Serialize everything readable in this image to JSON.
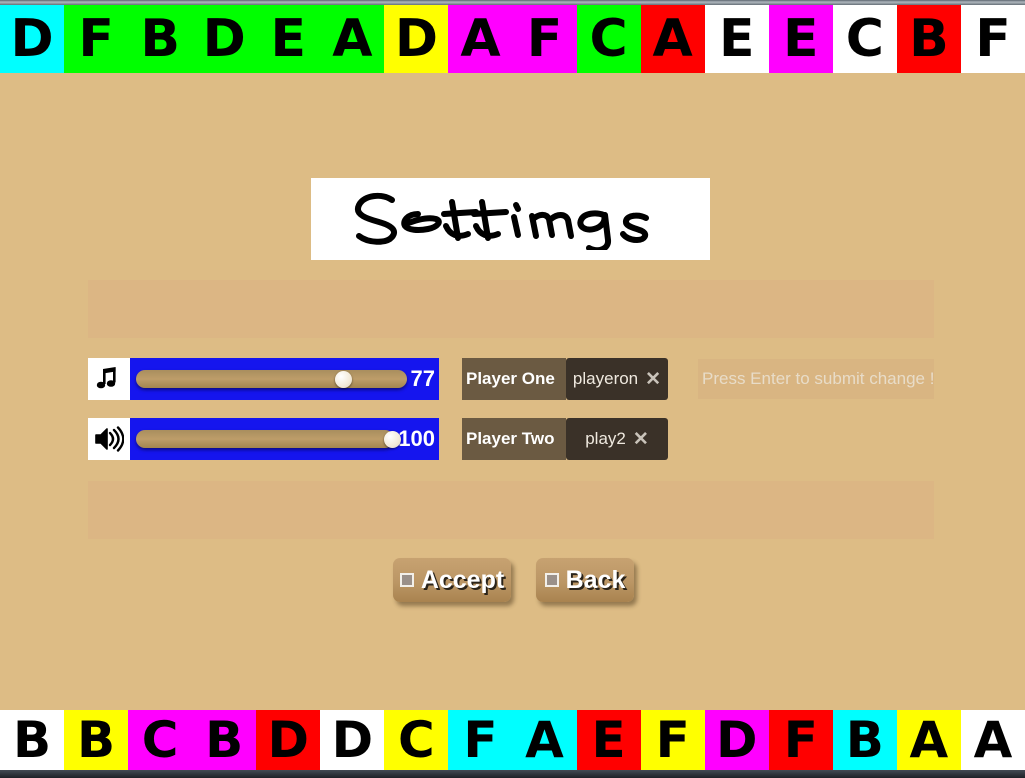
{
  "window": {
    "title": "Settings"
  },
  "top_strip": {
    "name": "top-letter-strip",
    "tiles": [
      {
        "letter": "D",
        "bg": "#00ffff"
      },
      {
        "letter": "F",
        "bg": "#00ff00"
      },
      {
        "letter": "B",
        "bg": "#00ff00"
      },
      {
        "letter": "D",
        "bg": "#00ff00"
      },
      {
        "letter": "E",
        "bg": "#00ff00"
      },
      {
        "letter": "A",
        "bg": "#00ff00"
      },
      {
        "letter": "D",
        "bg": "#ffff00"
      },
      {
        "letter": "A",
        "bg": "#ff00ff"
      },
      {
        "letter": "F",
        "bg": "#ff00ff"
      },
      {
        "letter": "C",
        "bg": "#00ff00"
      },
      {
        "letter": "A",
        "bg": "#ff0000"
      },
      {
        "letter": "E",
        "bg": "#ffffff"
      },
      {
        "letter": "E",
        "bg": "#ff00ff"
      },
      {
        "letter": "C",
        "bg": "#ffffff"
      },
      {
        "letter": "B",
        "bg": "#ff0000"
      },
      {
        "letter": "F",
        "bg": "#ffffff"
      }
    ]
  },
  "bottom_strip": {
    "name": "bottom-letter-strip",
    "tiles": [
      {
        "letter": "B",
        "bg": "#ffffff"
      },
      {
        "letter": "B",
        "bg": "#ffff00"
      },
      {
        "letter": "C",
        "bg": "#ff00ff"
      },
      {
        "letter": "B",
        "bg": "#ff00ff"
      },
      {
        "letter": "D",
        "bg": "#ff0000"
      },
      {
        "letter": "D",
        "bg": "#ffffff"
      },
      {
        "letter": "C",
        "bg": "#ffff00"
      },
      {
        "letter": "F",
        "bg": "#00ffff"
      },
      {
        "letter": "A",
        "bg": "#00ffff"
      },
      {
        "letter": "E",
        "bg": "#ff0000"
      },
      {
        "letter": "F",
        "bg": "#ffff00"
      },
      {
        "letter": "D",
        "bg": "#ff00ff"
      },
      {
        "letter": "F",
        "bg": "#ff0000"
      },
      {
        "letter": "B",
        "bg": "#00ffff"
      },
      {
        "letter": "A",
        "bg": "#ffff00"
      },
      {
        "letter": "A",
        "bg": "#ffffff"
      }
    ]
  },
  "title": {
    "text": "Settings",
    "style": "handwritten",
    "banner_bg": "#ffffff",
    "ink": "#000000"
  },
  "sliders": [
    {
      "id": "music-volume",
      "icon": "music-note-icon",
      "value": 77,
      "min": 0,
      "max": 100,
      "value_label": "77",
      "track_bg": "#b1九",
      "panel_bg": "#1515ee"
    },
    {
      "id": "sound-volume",
      "icon": "speaker-volume-icon",
      "value": 100,
      "min": 0,
      "max": 100,
      "value_label": "100",
      "panel_bg": "#1515ee"
    }
  ],
  "players": [
    {
      "id": "player-one",
      "label": "Player One",
      "value": "playeron",
      "clear_glyph": "✕"
    },
    {
      "id": "player-two",
      "label": "Player Two",
      "value": "play2",
      "clear_glyph": "✕"
    }
  ],
  "hint": {
    "text": "Press Enter to submit change !"
  },
  "buttons": [
    {
      "id": "accept-button",
      "label": "Accept"
    },
    {
      "id": "back-button",
      "label": "Back"
    }
  ],
  "colors": {
    "page_bg": "#ddbc85",
    "panel_bg": "#dcb684",
    "slider_blue": "#1515ee",
    "label_brown": "#6b5a42",
    "field_brown": "#3a3128",
    "button_tan": "#bb9665"
  }
}
